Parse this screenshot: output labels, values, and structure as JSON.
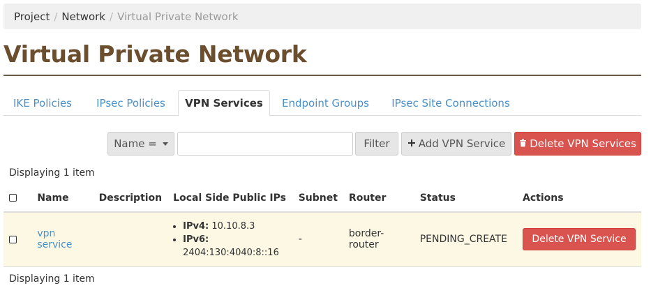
{
  "breadcrumb": {
    "items": [
      "Project",
      "Network",
      "Virtual Private Network"
    ],
    "separator": "/"
  },
  "page_title": "Virtual Private Network",
  "tabs": [
    {
      "label": "IKE Policies",
      "active": false
    },
    {
      "label": "IPsec Policies",
      "active": false
    },
    {
      "label": "VPN Services",
      "active": true
    },
    {
      "label": "Endpoint Groups",
      "active": false
    },
    {
      "label": "IPsec Site Connections",
      "active": false
    }
  ],
  "toolbar": {
    "filter_field_label": "Name =",
    "search_value": "",
    "filter_label": "Filter",
    "add_label": "Add VPN Service",
    "delete_label": "Delete VPN Services",
    "add_icon": "plus-icon",
    "delete_icon": "trash-icon"
  },
  "table": {
    "count_text": "Displaying 1 item",
    "columns": [
      "Name",
      "Description",
      "Local Side Public IPs",
      "Subnet",
      "Router",
      "Status",
      "Actions"
    ],
    "rows": [
      {
        "name": "vpn service",
        "description": "",
        "ips": [
          {
            "label": "IPv4:",
            "value": "10.10.8.3"
          },
          {
            "label": "IPv6:",
            "value": "2404:130:4040:8::16"
          }
        ],
        "subnet": "-",
        "router": "border-router",
        "status": "PENDING_CREATE",
        "action_label": "Delete VPN Service"
      }
    ]
  },
  "colors": {
    "title": "#6b4e2e",
    "link": "#4a90c9",
    "danger": "#d9534f",
    "row_highlight": "#fcf8e3"
  }
}
